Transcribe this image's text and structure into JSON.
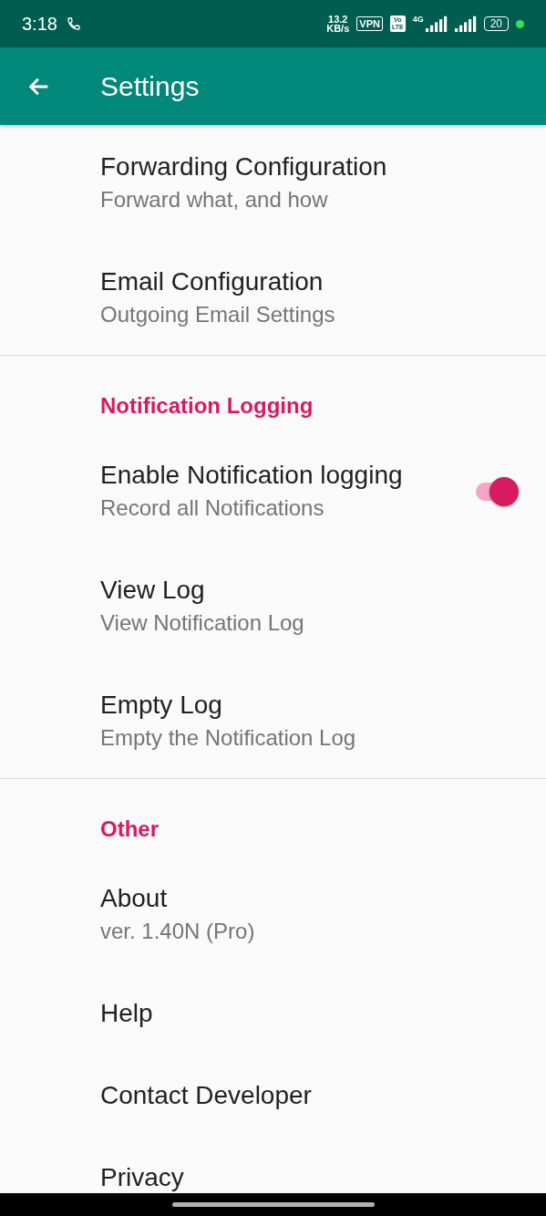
{
  "status_bar": {
    "time": "3:18",
    "speed_value": "13.2",
    "speed_unit": "KB/s",
    "vpn": "VPN",
    "volte_top": "Vo",
    "volte_bottom": "LTE",
    "network": "4G",
    "battery": "20"
  },
  "app_bar": {
    "title": "Settings"
  },
  "sections": [
    {
      "items": [
        {
          "kind": "link",
          "title": "Forwarding Configuration",
          "subtitle": "Forward what, and how"
        },
        {
          "kind": "link",
          "title": "Email Configuration",
          "subtitle": "Outgoing Email Settings"
        }
      ]
    },
    {
      "header": "Notification Logging",
      "items": [
        {
          "kind": "switch",
          "title": "Enable Notification logging",
          "subtitle": "Record all Notifications",
          "checked": true
        },
        {
          "kind": "link",
          "title": "View Log",
          "subtitle": "View Notification Log"
        },
        {
          "kind": "link",
          "title": "Empty Log",
          "subtitle": "Empty the Notification Log"
        }
      ]
    },
    {
      "header": "Other",
      "items": [
        {
          "kind": "link",
          "title": "About",
          "subtitle": "ver. 1.40N (Pro)"
        },
        {
          "kind": "link",
          "title": "Help"
        },
        {
          "kind": "link",
          "title": "Contact Developer"
        },
        {
          "kind": "link",
          "title": "Privacy"
        }
      ]
    }
  ]
}
